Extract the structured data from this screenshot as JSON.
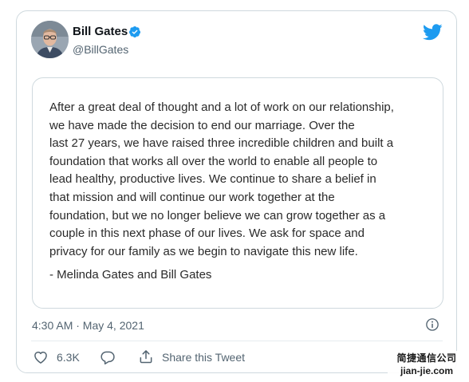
{
  "author": {
    "name": "Bill Gates",
    "handle": "@BillGates",
    "verified": true
  },
  "statement": {
    "body": "After a great deal of thought and a lot of work on our relationship,\nwe have made the decision to end our marriage. Over the\nlast 27 years, we have raised three incredible children and built a\nfoundation that works all over the world to enable all people to\nlead healthy, productive lives. We continue to share a belief in\nthat mission and will continue our work together at the\nfoundation, but we no longer believe we can grow together as a\ncouple in this next phase of our lives. We ask for space and\nprivacy for our family as we begin to navigate this new life.",
    "signature": "- Melinda Gates and Bill Gates"
  },
  "meta": {
    "timestamp": "4:30 AM · May 4, 2021"
  },
  "actions": {
    "like_count": "6.3K",
    "share_label": "Share this Tweet"
  },
  "watermark": {
    "line1": "简捷通信公司",
    "line2": "jian-jie.com"
  },
  "colors": {
    "twitter_blue": "#1d9bf0",
    "secondary_text": "#536471",
    "border": "#cfd9de"
  },
  "icons": [
    "avatar",
    "verified-badge-icon",
    "twitter-bird-icon",
    "info-icon",
    "heart-icon",
    "reply-icon",
    "share-icon"
  ]
}
